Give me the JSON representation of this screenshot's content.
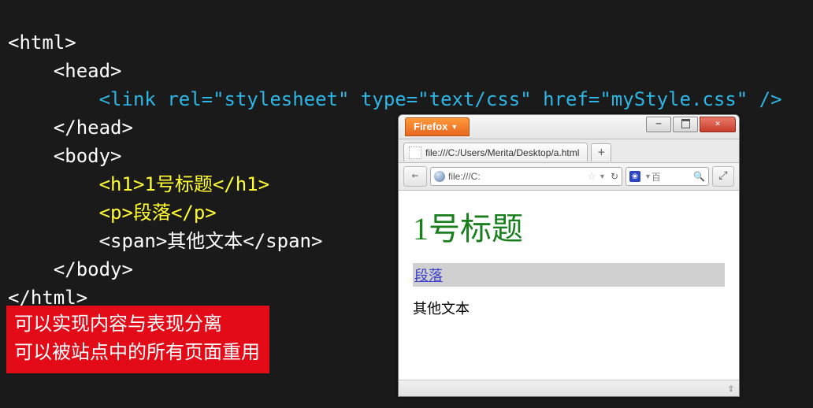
{
  "code": {
    "l1": "<html>",
    "l2": "    <head>",
    "l3": "        <link rel=\"stylesheet\" type=\"text/css\" href=\"myStyle.css\" />",
    "l4": "    </head>",
    "l5": "    <body>",
    "l6": "        <h1>1号标题</h1>",
    "l7": "        <p>段落</p>",
    "l8a": "        <span>其他文本</span>",
    "l9": "    </body>",
    "l10": "</html>"
  },
  "callout": {
    "line1": "可以实现内容与表现分离",
    "line2": "可以被站点中的所有页面重用"
  },
  "browser": {
    "firefox_label": "Firefox",
    "tab_title": "file:///C:/Users/Merita/Desktop/a.html",
    "url_text": "file:///C:",
    "search_placeholder": "百",
    "page": {
      "h1": "1号标题",
      "p": "段落",
      "span": "其他文本"
    }
  }
}
